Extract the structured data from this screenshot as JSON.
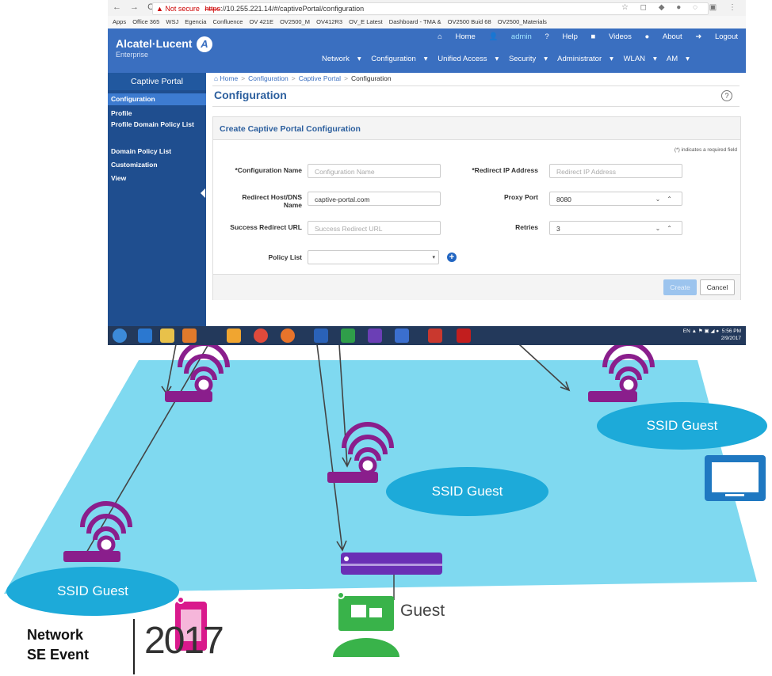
{
  "browser": {
    "nav_glyphs": "← → C",
    "warning": "▲ Not secure",
    "url_scheme": "https",
    "url_path": "://10.255.221.14/#/captivePortal/configuration",
    "bookmarks": [
      "Apps",
      "Office 365",
      "WSJ",
      "Egencia",
      "Confluence",
      "OV 421E",
      "OV2500_M",
      "OV412R3",
      "OV_E Latest",
      "Dashboard - TMA &",
      "OV2500 Buid 68",
      "OV2500_Materials"
    ],
    "tray_lang": "EN",
    "tray_time": "5:56 PM",
    "tray_date": "2/9/2017"
  },
  "app": {
    "brand": "Alcatel·Lucent",
    "brand_sub": "Enterprise",
    "brand_mark": "A",
    "top_links": [
      "Home",
      "admin",
      "Help",
      "Videos",
      "About",
      "Logout"
    ],
    "main_menu": [
      "Network",
      "Configuration",
      "Unified Access",
      "Security",
      "Administrator",
      "WLAN",
      "AM"
    ],
    "sidebar_title": "Captive Portal",
    "sidebar_items": [
      "Configuration",
      "Profile",
      "Profile Domain Policy List",
      "Domain Policy List",
      "Customization",
      "View"
    ],
    "breadcrumb": [
      "Home",
      "Configuration",
      "Captive Portal",
      "Configuration"
    ],
    "page_title": "Configuration",
    "panel_title": "Create Captive Portal Configuration",
    "required_note": "(*) indicates a required field",
    "form": {
      "config_name_label": "*Configuration Name",
      "config_name_placeholder": "Configuration Name",
      "redirect_host_label": "Redirect Host/DNS Name",
      "redirect_host_value": "captive-portal.com",
      "success_url_label": "Success Redirect URL",
      "success_url_placeholder": "Success Redirect URL",
      "policy_list_label": "Policy List",
      "redirect_ip_label": "*Redirect IP Address",
      "redirect_ip_placeholder": "Redirect IP Address",
      "proxy_port_label": "Proxy Port",
      "proxy_port_value": "8080",
      "retries_label": "Retries",
      "retries_value": "3"
    },
    "create_button": "Create",
    "cancel_button": "Cancel"
  },
  "diagram": {
    "ssid_label": "SSID Guest",
    "guest_label": "Guest",
    "event_title": "Network\nSE Event",
    "year": "2017",
    "colors": {
      "floor": "#7fd9f0",
      "ssid": "#1daad9",
      "router": "#8a1e8c",
      "switch": "#6a2fb5",
      "laptop": "#39b34a",
      "phone": "#d9198c",
      "tablet": "#1f78c1"
    }
  }
}
